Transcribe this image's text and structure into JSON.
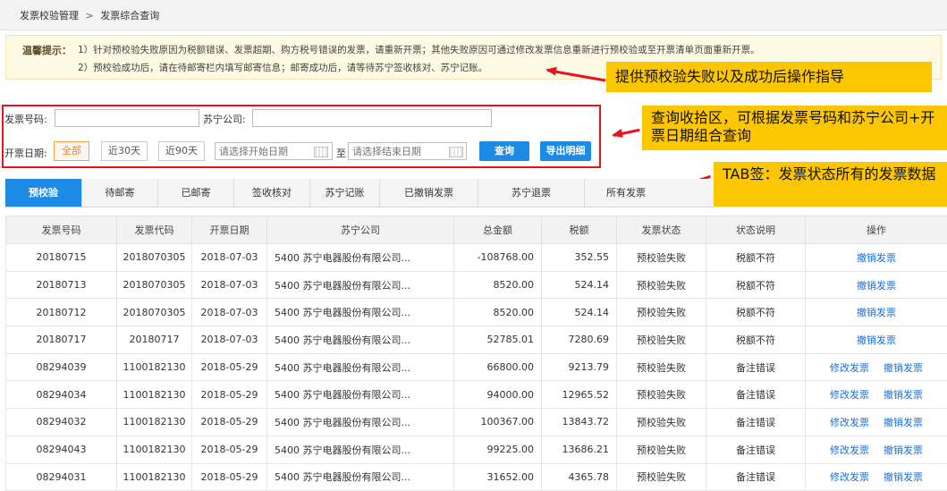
{
  "breadcrumb": {
    "parent": "发票校验管理",
    "separator": ">",
    "current": "发票综合查询"
  },
  "tips": {
    "label": "温馨提示：",
    "line1": "1）针对预校验失败原因为税额错误、发票超期、购方税号错误的发票，请重新开票；其他失败原因可通过修改发票信息重新进行预校验或至开票清单页面重新开票。",
    "line2": "2）预校验成功后，请在待邮寄栏内填写邮寄信息；邮寄成功后，请等待苏宁签收核对、苏宁记账。"
  },
  "callouts": {
    "tips_note": "提供预校验失败以及成功后操作指导",
    "search_note": "查询收拾区，可根据发票号码和苏宁公司+开票日期组合查询",
    "tab_note": "TAB签：发票状态所有的发票数据"
  },
  "colors": {
    "accent": "#1d8ae5",
    "annotation_red": "#e8141c",
    "callout_bg": "#fcc700",
    "active_orange": "#f07f1a"
  },
  "search": {
    "invoice_no_label": "发票号码:",
    "invoice_no_value": "",
    "company_label": "苏宁公司:",
    "company_value": "",
    "date_label": "开票日期:",
    "range_all": "全部",
    "range_30": "近30天",
    "range_90": "近90天",
    "start_placeholder": "请选择开始日期",
    "to_label": "至",
    "end_placeholder": "请选择结束日期",
    "query_button": "查询",
    "export_button": "导出明细",
    "calendar_icon": "calendar-icon"
  },
  "tabs": [
    "预校验",
    "待邮寄",
    "已邮寄",
    "签收核对",
    "苏宁记账",
    "已撤销发票",
    "苏宁退票",
    "所有发票"
  ],
  "table": {
    "headers": [
      "发票号码",
      "发票代码",
      "开票日期",
      "苏宁公司",
      "总金额",
      "税额",
      "发票状态",
      "状态说明",
      "操作"
    ],
    "rows": [
      {
        "no": "20180715",
        "code": "2018070305",
        "date": "2018-07-03",
        "company": "5400  苏宁电器股份有限公司...",
        "amount": "-108768.00",
        "tax": "352.55",
        "status": "预校验失败",
        "desc": "税额不符",
        "ops": [
          "撤销发票"
        ]
      },
      {
        "no": "20180713",
        "code": "2018070305",
        "date": "2018-07-03",
        "company": "5400  苏宁电器股份有限公司...",
        "amount": "8520.00",
        "tax": "524.14",
        "status": "预校验失败",
        "desc": "税额不符",
        "ops": [
          "撤销发票"
        ]
      },
      {
        "no": "20180712",
        "code": "2018070305",
        "date": "2018-07-03",
        "company": "5400  苏宁电器股份有限公司...",
        "amount": "8520.00",
        "tax": "524.14",
        "status": "预校验失败",
        "desc": "税额不符",
        "ops": [
          "撤销发票"
        ]
      },
      {
        "no": "20180717",
        "code": "20180717",
        "date": "2018-07-03",
        "company": "5400  苏宁电器股份有限公司...",
        "amount": "52785.01",
        "tax": "7280.69",
        "status": "预校验失败",
        "desc": "税额不符",
        "ops": [
          "撤销发票"
        ]
      },
      {
        "no": "08294039",
        "code": "1100182130",
        "date": "2018-05-29",
        "company": "5400  苏宁电器股份有限公司...",
        "amount": "66800.00",
        "tax": "9213.79",
        "status": "预校验失败",
        "desc": "备注错误",
        "ops": [
          "修改发票",
          "撤销发票"
        ]
      },
      {
        "no": "08294034",
        "code": "1100182130",
        "date": "2018-05-29",
        "company": "5400  苏宁电器股份有限公司...",
        "amount": "94000.00",
        "tax": "12965.52",
        "status": "预校验失败",
        "desc": "备注错误",
        "ops": [
          "修改发票",
          "撤销发票"
        ]
      },
      {
        "no": "08294032",
        "code": "1100182130",
        "date": "2018-05-29",
        "company": "5400  苏宁电器股份有限公司...",
        "amount": "100367.00",
        "tax": "13843.72",
        "status": "预校验失败",
        "desc": "备注错误",
        "ops": [
          "修改发票",
          "撤销发票"
        ]
      },
      {
        "no": "08294043",
        "code": "1100182130",
        "date": "2018-05-29",
        "company": "5400  苏宁电器股份有限公司...",
        "amount": "99225.00",
        "tax": "13686.21",
        "status": "预校验失败",
        "desc": "备注错误",
        "ops": [
          "修改发票",
          "撤销发票"
        ]
      },
      {
        "no": "08294031",
        "code": "1100182130",
        "date": "2018-05-29",
        "company": "5400  苏宁电器股份有限公司...",
        "amount": "31652.00",
        "tax": "4365.78",
        "status": "预校验失败",
        "desc": "备注错误",
        "ops": [
          "修改发票",
          "撤销发票"
        ]
      }
    ]
  }
}
